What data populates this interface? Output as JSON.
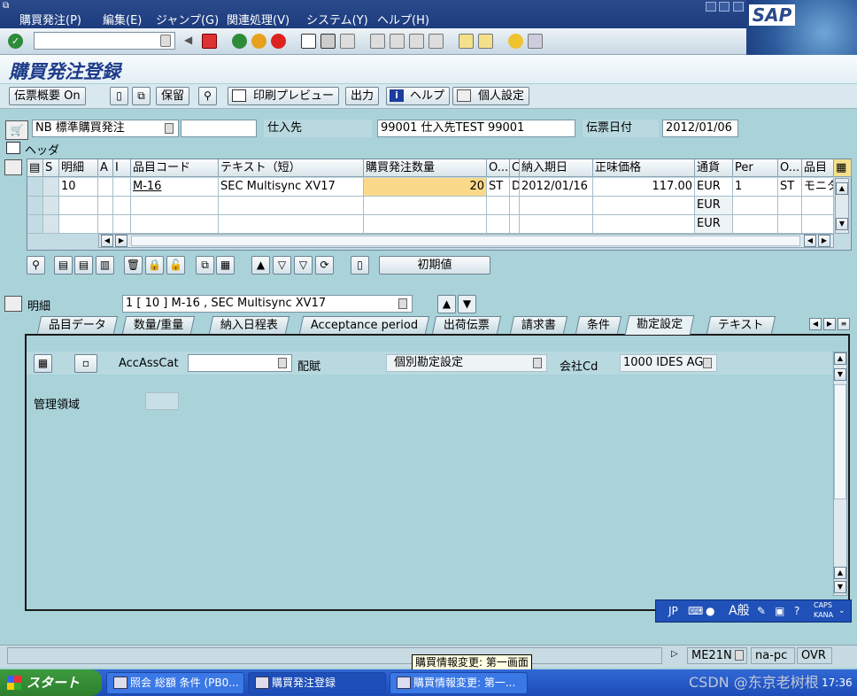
{
  "menu": [
    "購買発注(P)",
    "編集(E)",
    "ジャンプ(G)",
    "関連処理(V)",
    "システム(Y)",
    "ヘルプ(H)"
  ],
  "logo": "SAP",
  "screen_title": "購買発注登録",
  "app_toolbar": {
    "doc_overview": "伝票概要 On",
    "hold": "保留",
    "print_preview": "印刷プレビュー",
    "output": "出力",
    "help": "ヘルプ",
    "personal_settings": "個人設定"
  },
  "header": {
    "po_type": "NB 標準購買発注",
    "po_number": "",
    "vendor_label": "仕入先",
    "vendor_value": "99001 仕入先TEST 99001",
    "doc_date_label": "伝票日付",
    "doc_date_value": "2012/01/06",
    "header_label": "ヘッダ"
  },
  "item_grid": {
    "columns": [
      "S",
      "明細",
      "A",
      "I",
      "品目コード",
      "テキスト（短）",
      "購買発注数量",
      "O...",
      "C",
      "納入期日",
      "正味価格",
      "通貨",
      "Per",
      "O...",
      "品目"
    ],
    "rows": [
      [
        "",
        "10",
        "",
        "",
        "M-16",
        "SEC Multisync XV17",
        "20",
        "ST",
        "D",
        "2012/01/16",
        "117.00",
        "EUR",
        "1",
        "ST",
        "モニタ"
      ],
      [
        "",
        "",
        "",
        "",
        "",
        "",
        "",
        "",
        "",
        "",
        "",
        "EUR",
        "",
        "",
        ""
      ],
      [
        "",
        "",
        "",
        "",
        "",
        "",
        "",
        "",
        "",
        "",
        "",
        "EUR",
        "",
        "",
        ""
      ]
    ],
    "default_values_button": "初期値"
  },
  "item_detail": {
    "label": "明細",
    "selected_item": "1 [ 10 ] M-16 , SEC Multisync XV17",
    "tabs": [
      "品目データ",
      "数量/重量",
      "納入日程表",
      "Acceptance period",
      "出荷伝票",
      "請求書",
      "条件",
      "勘定設定",
      "テキスト"
    ],
    "active_tab": "勘定設定",
    "acc_ass_cat_label": "AccAssCat",
    "acc_ass_cat_value": "",
    "distribution_label": "配賦",
    "distribution_value": "個別勘定設定",
    "company_code_label": "会社Cd",
    "company_code_value": "1000 IDES AG",
    "business_area_label": "管理領域",
    "business_area_value": ""
  },
  "ime_bar": {
    "lang": "JP",
    "mode": "A般",
    "caps": "CAPS",
    "kana": "KANA"
  },
  "statusbar": {
    "tooltip": "購買情報変更: 第一画面",
    "transaction": "ME21N",
    "server": "na-pc",
    "mode": "OVR"
  },
  "taskbar": {
    "start": "スタート",
    "tasks": [
      "照会 総額 条件 (PB0...",
      "購買発注登録",
      "購買情報変更: 第一..."
    ],
    "time": "17:36"
  },
  "watermark": "CSDN @东京老树根"
}
